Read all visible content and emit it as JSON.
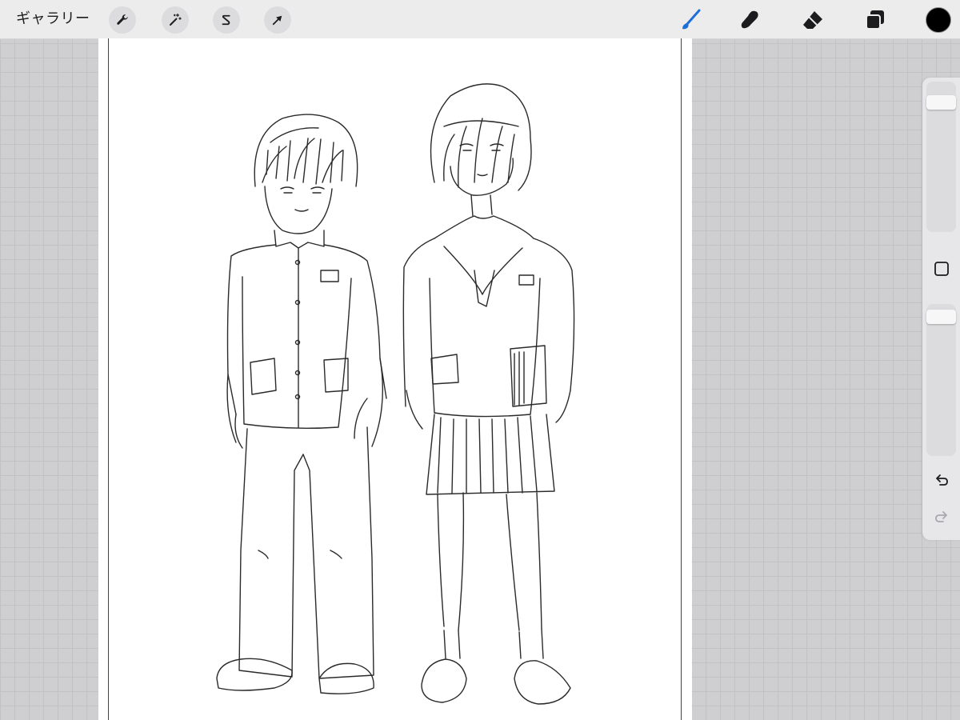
{
  "toolbar": {
    "gallery_label": "ギャラリー",
    "left_tools": [
      {
        "name": "actions",
        "icon": "wrench-icon"
      },
      {
        "name": "adjustments",
        "icon": "magic-wand-icon"
      },
      {
        "name": "selection",
        "icon": "selection-s-icon"
      },
      {
        "name": "transform",
        "icon": "arrow-cursor-icon"
      }
    ],
    "right_tools": [
      {
        "name": "brush",
        "icon": "brush-icon",
        "active": true
      },
      {
        "name": "smudge",
        "icon": "smudge-icon",
        "active": false
      },
      {
        "name": "eraser",
        "icon": "eraser-icon",
        "active": false
      },
      {
        "name": "layers",
        "icon": "layers-icon",
        "active": false
      }
    ],
    "current_color": "#000000",
    "accent_color": "#1d6fd8"
  },
  "sidebar": {
    "brush_size_level": 0.1,
    "opacity_level": 0.04,
    "modify_icon": "square-icon",
    "undo_icon": "undo-icon",
    "redo_icon": "redo-icon",
    "redo_enabled": false
  },
  "canvas": {
    "background": "#ffffff",
    "artwork": "pencil-sketch-two-students-in-school-uniforms"
  }
}
